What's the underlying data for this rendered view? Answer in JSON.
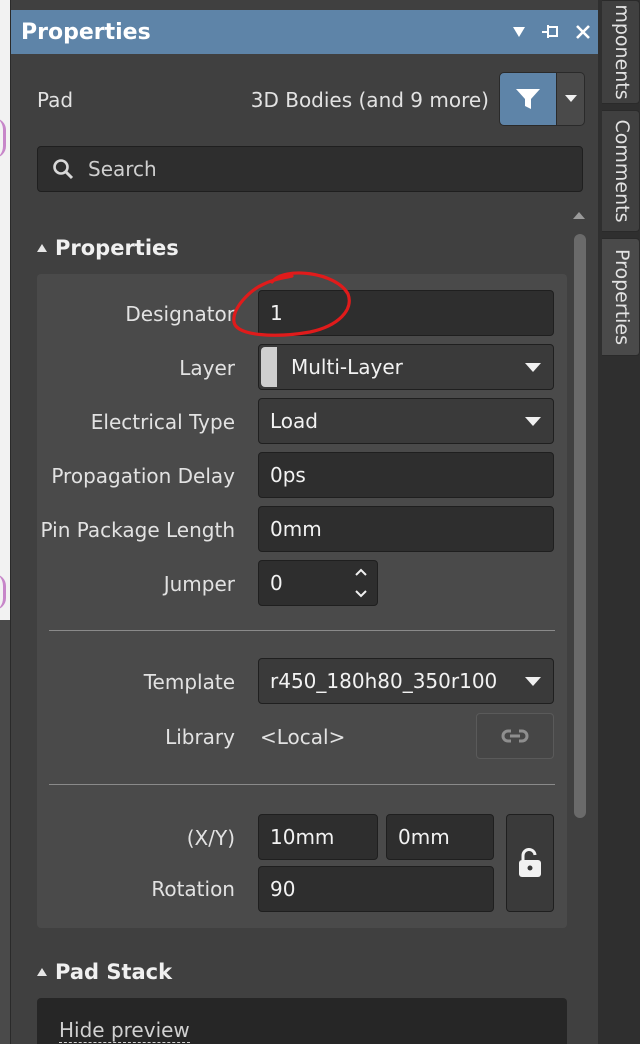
{
  "panel": {
    "title": "Properties",
    "object_type": "Pad",
    "filter_summary": "3D Bodies (and 9 more)",
    "search_placeholder": "Search"
  },
  "properties_section": {
    "heading": "Properties",
    "designator": {
      "label": "Designator",
      "value": "1"
    },
    "layer": {
      "label": "Layer",
      "value": "Multi-Layer"
    },
    "electrical_type": {
      "label": "Electrical Type",
      "value": "Load"
    },
    "propagation_delay": {
      "label": "Propagation Delay",
      "value": "0ps"
    },
    "pin_package_length": {
      "label": "Pin Package Length",
      "value": "0mm"
    },
    "jumper": {
      "label": "Jumper",
      "value": "0"
    },
    "template": {
      "label": "Template",
      "value": "r450_180h80_350r100"
    },
    "library": {
      "label": "Library",
      "value": "<Local>"
    },
    "xy": {
      "label": "(X/Y)",
      "x": "10mm",
      "y": "0mm"
    },
    "rotation": {
      "label": "Rotation",
      "value": "90"
    }
  },
  "pad_stack_section": {
    "heading": "Pad Stack",
    "hide_preview": "Hide preview"
  },
  "side_tabs": [
    "mponents",
    "Comments",
    "Properties"
  ],
  "colors": {
    "title_bar": "#5e84a8",
    "panel_bg": "#404040",
    "group_bg": "#4a4a4a",
    "field_bg": "#2e2e2e",
    "annotation": "#e01b1b"
  }
}
